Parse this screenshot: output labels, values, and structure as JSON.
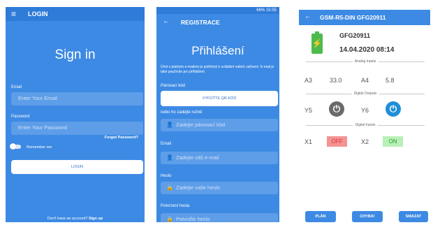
{
  "screen1": {
    "title": "LOGIN",
    "heading": "Sign in",
    "email_label": "Email",
    "email_placeholder": "Enter Your Email",
    "password_label": "Password",
    "password_placeholder": "Enter Your Password",
    "forgot": "Forgot Password?",
    "remember": "Remember me",
    "login_button": "LOGIN",
    "no_account": "Don't have an account?",
    "signup": "Sign up"
  },
  "screen2": {
    "status": "66% 15:55",
    "title": "REGISTRACE",
    "heading": "Přihlášení",
    "description": "Účet s platným e-mailem je potřebný k ovládání vašich zařízení. E-mail je také používán pro přihlášení.",
    "pairing_label": "Párovací kód",
    "qr_button": "VYFOŤTE QR KÓD",
    "manual_label": "nebo ho zadejte ručně",
    "pairing_placeholder": "Zadejte párovací kód",
    "email_label": "Email",
    "email_placeholder": "Zadejte váš e-mail",
    "password_label": "Heslo",
    "password_placeholder": "Zadejte vaše heslo",
    "confirm_label": "Potvrzení hesla",
    "confirm_placeholder": "Potvrďte heslo"
  },
  "screen3": {
    "title": "GSM-R5-DIN GFG20911",
    "device_name": "GFG20911",
    "date": "14.04.2020 08:14",
    "analog_section": "Analog Inputs",
    "a3_label": "A3",
    "a3_value": "33.0",
    "a4_label": "A4",
    "a4_value": "5.8",
    "outputs_section": "Digital Outputs",
    "y5_label": "Y5",
    "y6_label": "Y6",
    "inputs_section": "Digital Inputs",
    "x1_label": "X1",
    "x1_state": "OFF",
    "x2_label": "X2",
    "x2_state": "ON",
    "btn_plan": "PLÁN",
    "btn_errors": "CHYBA!",
    "btn_delete": "SMAZAT"
  }
}
